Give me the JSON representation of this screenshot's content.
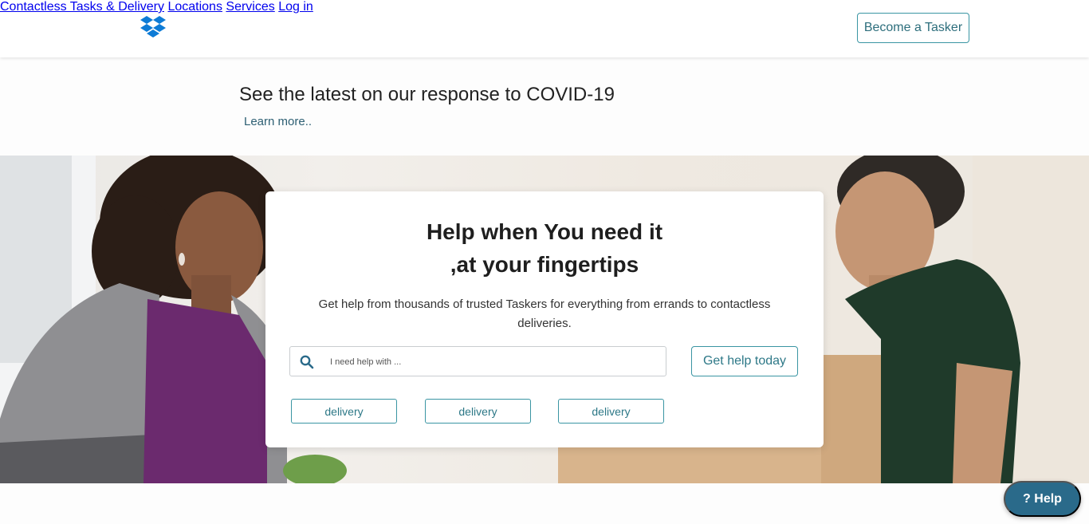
{
  "header": {
    "logo_icon": "dropbox-logo-icon",
    "nav": [
      {
        "label": "Contactless Tasks & Delivery"
      },
      {
        "label": "Locations"
      },
      {
        "label": "Services"
      },
      {
        "label": "Log in"
      }
    ],
    "cta_label": "Become a Tasker"
  },
  "covid": {
    "title": "See the latest on our response to COVID-19",
    "link": "Learn more.."
  },
  "hero": {
    "title_line1": "Help when You need it",
    "title_line2": ",at your fingertips",
    "subtitle": "Get help from thousands of trusted Taskers for everything from errands to contactless deliveries.",
    "search": {
      "placeholder": "I need help with ...",
      "value": ""
    },
    "cta_label": "Get help today",
    "chips": [
      "delivery",
      "delivery",
      "delivery"
    ]
  },
  "help_button": "? Help",
  "colors": {
    "accent": "#3a95a3",
    "nav_text": "#2d5f73",
    "help_bubble": "#2a6a8a",
    "logo_blue": "#0d7bd6"
  }
}
